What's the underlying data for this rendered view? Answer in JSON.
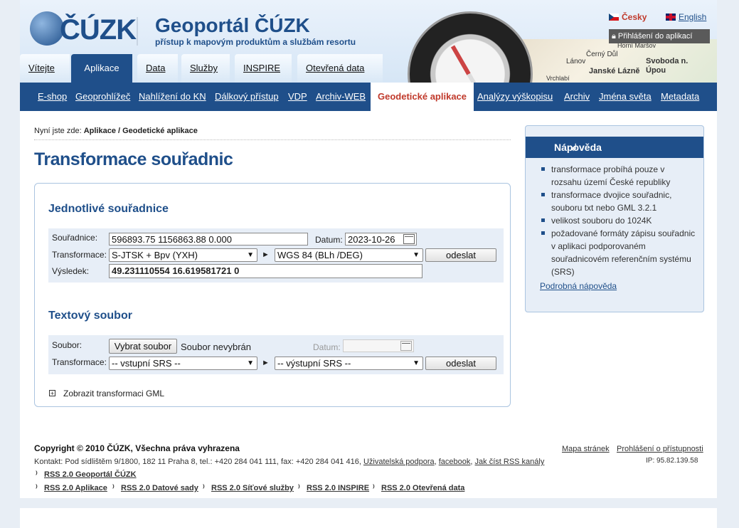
{
  "header": {
    "logo_text": "ČÚZK",
    "title": "Geoportál ČÚZK",
    "subtitle": "přístup k mapovým produktům a službám resortu",
    "lang_cs": "Česky",
    "lang_en": "English",
    "login": "Přihlášení do aplikací",
    "map_labels": [
      "Černý Důl",
      "Horní Maršov",
      "Lánov",
      "Svoboda n. Úpou",
      "Janské Lázně",
      "Vrchlabí"
    ]
  },
  "tabs": [
    {
      "label": "Vítejte"
    },
    {
      "label": "Aplikace"
    },
    {
      "label": "Data"
    },
    {
      "label": "Služby"
    },
    {
      "label": "INSPIRE"
    },
    {
      "label": "Otevřená data"
    }
  ],
  "subnav": [
    {
      "label": "E-shop"
    },
    {
      "label": "Geoprohlížeč"
    },
    {
      "label": "Nahlížení do KN"
    },
    {
      "label": "Dálkový přístup"
    },
    {
      "label": "VDP"
    },
    {
      "label": "Archiv-WEB"
    },
    {
      "label": "Geodetické aplikace"
    },
    {
      "label": "Analýzy výškopisu"
    },
    {
      "label": "Archiv"
    },
    {
      "label": "Jména světa"
    },
    {
      "label": "Metadata"
    }
  ],
  "breadcrumb": {
    "prefix": "Nyní jste zde: ",
    "path": "Aplikace / Geodetické aplikace"
  },
  "page_title": "Transformace souřadnic",
  "single": {
    "heading": "Jednotlivé souřadnice",
    "coords_label": "Souřadnice:",
    "coords_value": "596893.75 1156863.88 0.000",
    "date_label": "Datum:",
    "date_value": "2023-10-26",
    "transform_label": "Transformace:",
    "from_srs": "S-JTSK + Bpv (YXH)",
    "to_srs": "WGS 84 (BLh /DEG)",
    "submit": "odeslat",
    "result_label": "Výsledek:",
    "result_value": "49.231110554 16.619581721 0"
  },
  "file": {
    "heading": "Textový soubor",
    "file_label": "Soubor:",
    "choose": "Vybrat soubor",
    "none": "Soubor nevybrán",
    "date_label": "Datum:",
    "transform_label": "Transformace:",
    "from_placeholder": "-- vstupní SRS --",
    "to_placeholder": "-- výstupní SRS --",
    "submit": "odeslat"
  },
  "gml_toggle": "Zobrazit transformaci GML",
  "arrow_glyph": "►",
  "help": {
    "title": "Nápověda",
    "items": [
      "transformace probíhá pouze v rozsahu území České republiky",
      "transformace dvojice souřadnic, souboru txt nebo GML 3.2.1",
      "velikost souboru do 1024K",
      "požadované formáty zápisu souřadnic v aplikaci podporovaném souřadnicovém referenčním systému (SRS)"
    ],
    "link": "Podrobná nápověda"
  },
  "footer": {
    "copyright": "Copyright © 2010 ČÚZK, Všechna práva vyhrazena",
    "contact": "Kontakt: Pod sídlištěm 9/1800, 182 11 Praha 8, tel.: +420 284 041 111, fax: +420 284 041 416, ",
    "support": "Uživatelská podpora",
    "facebook": "facebook",
    "rss_howto": "Jak číst RSS kanály",
    "sitemap": "Mapa stránek",
    "accessibility": "Prohlášení o přístupnosti",
    "ip": "IP: 95.82.139.58",
    "rss_main": "RSS 2.0 Geoportál ČÚZK",
    "rss_items": [
      "RSS 2.0 Aplikace",
      "RSS 2.0 Datové sady",
      "RSS 2.0 Síťové služby",
      "RSS 2.0 INSPIRE",
      "RSS 2.0 Otevřená data"
    ]
  },
  "colors": {
    "brand": "#1f4f8a",
    "accent": "#c0392b",
    "panel": "#e7eef7"
  }
}
